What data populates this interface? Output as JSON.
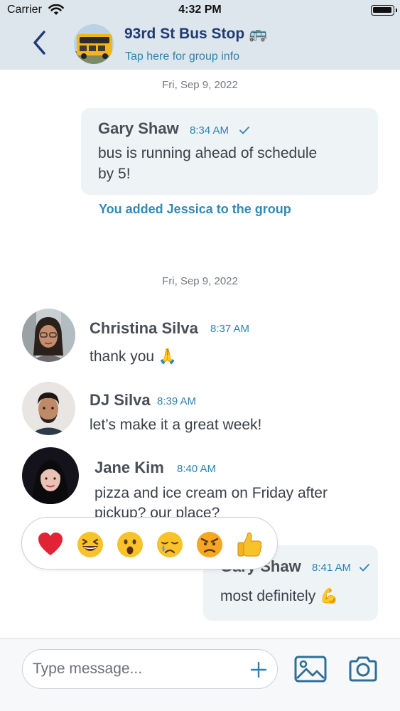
{
  "status_bar": {
    "carrier": "Carrier",
    "time": "4:32 PM"
  },
  "header": {
    "title": "93rd St Bus Stop 🚌",
    "subtitle": "Tap here for group info",
    "avatar_text": "SCHOOL BUS"
  },
  "chat": {
    "date_1": "Fri, Sep 9, 2022",
    "date_2": "Fri, Sep 9, 2022",
    "messages": [
      {
        "sender": "Gary Shaw",
        "time": "8:34 AM",
        "lines": [
          "bus is running ahead of schedule",
          "by 5!"
        ]
      },
      {
        "sender": "Christina Silva",
        "time": "8:37 AM",
        "text": "thank you 🙏"
      },
      {
        "sender": "DJ Silva",
        "time": "8:39 AM",
        "text": "let’s make it a great week!"
      },
      {
        "sender": "Jane Kim",
        "time": "8:40 AM",
        "lines": [
          "pizza and ice cream on Friday after",
          "pickup? our place?"
        ]
      },
      {
        "sender": "Gary Shaw",
        "time": "8:41 AM",
        "text": "most definitely 💪"
      }
    ],
    "system_message": "You added Jessica to the group"
  },
  "reactions": [
    "❤️",
    "😆",
    "😮",
    "😢",
    "😠",
    "👍"
  ],
  "input": {
    "placeholder": "Type message..."
  },
  "colors": {
    "header_bg": "#dde6ec",
    "title": "#1f3b72",
    "accent": "#2f82b0",
    "bubble": "#eef3f6"
  },
  "icons": [
    "back-chevron-icon",
    "wifi-icon",
    "battery-icon",
    "checkmark-icon",
    "plus-icon",
    "image-icon",
    "camera-icon"
  ]
}
